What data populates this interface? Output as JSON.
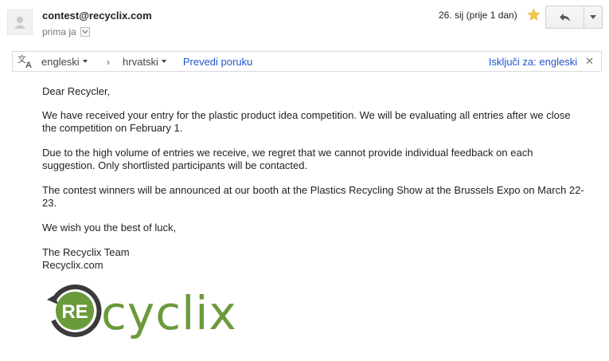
{
  "header": {
    "sender": "contest@recyclix.com",
    "to_label": "prima ja",
    "date": "26. sij (prije 1 dan)"
  },
  "translate_bar": {
    "source_lang": "engleski",
    "target_lang": "hrvatski",
    "translate_link": "Prevedi poruku",
    "turn_off": "Isključi za: engleski"
  },
  "message": {
    "greeting": "Dear Recycler,",
    "p1_l1": "We have received your entry for the plastic product idea competition. We will be evaluating all entries after we close",
    "p1_l2": "the competition on February 1.",
    "p2_l1": "Due to the high volume of entries we receive, we regret that we cannot provide individual feedback on each",
    "p2_l2": "suggestion. Only shortlisted participants will be contacted.",
    "p3_l1": "The contest winners will be announced at our booth at the Plastics Recycling Show at the Brussels Expo on March 22-",
    "p3_l2": "23.",
    "closing": "We wish you the best of luck,",
    "sig1": "The Recyclix Team",
    "sig2": "Recyclix.com"
  },
  "logo": {
    "badge": "RE",
    "word": "cyclix"
  },
  "colors": {
    "brand_green": "#6b9a3a",
    "brand_dark": "#3a3a3a",
    "link_blue": "#2255cc",
    "star": "#f7c744"
  },
  "icons": [
    "default-avatar-icon",
    "chevron-down-icon",
    "star-icon",
    "reply-icon",
    "translate-icon",
    "close-icon"
  ]
}
